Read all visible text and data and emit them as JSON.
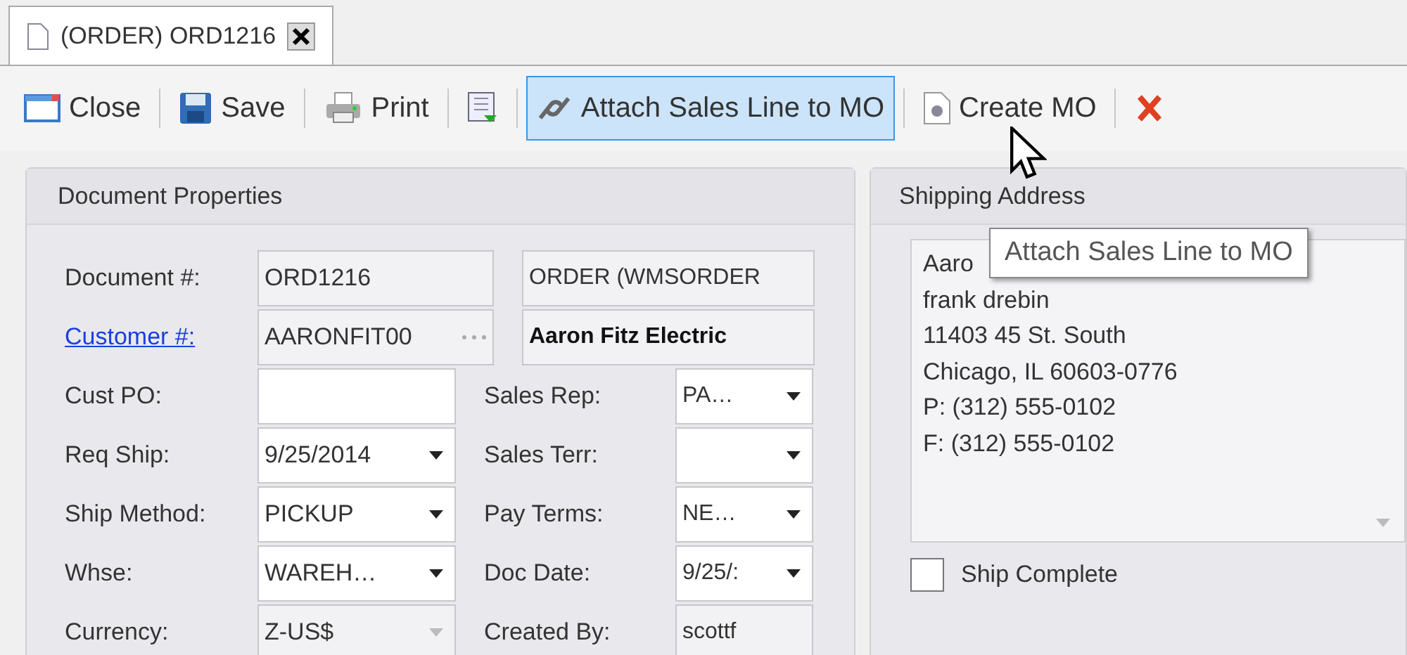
{
  "tab": {
    "title": "(ORDER) ORD1216",
    "selected": true
  },
  "toolbar": [
    {
      "label": "Close",
      "hovered": false
    },
    {
      "label": "Save",
      "hovered": false
    },
    {
      "label": "Print",
      "hovered": false
    },
    {
      "hovered": false
    },
    {
      "label": "Attach Sales Line to MO",
      "hovered": true
    },
    {
      "label": "Create MO",
      "hovered": false
    },
    {
      "hovered": false
    }
  ],
  "document_properties": {
    "title": "Document Properties",
    "top_rows": [
      {
        "label": "Document #:",
        "link": false,
        "value": "ORD1216",
        "extra": "ORDER (WMSORDER",
        "extra_bold": false,
        "lookup": false
      },
      {
        "label": "Customer #:",
        "link": true,
        "value": "AARONFIT00",
        "extra": "Aaron Fitz Electric",
        "extra_bold": true,
        "lookup": true
      }
    ],
    "rows": [
      {
        "left": {
          "label": "Cust PO:",
          "kind": "text",
          "disabled": false
        },
        "right": {
          "label": "Sales Rep:",
          "value": "PA…",
          "kind": "combo",
          "disabled": false
        }
      },
      {
        "left": {
          "label": "Req Ship:",
          "value": "9/25/2014",
          "kind": "combo",
          "disabled": false
        },
        "right": {
          "label": "Sales Terr:",
          "kind": "combo",
          "disabled": false
        }
      },
      {
        "left": {
          "label": "Ship Method:",
          "value": "PICKUP",
          "kind": "combo",
          "disabled": false
        },
        "right": {
          "label": "Pay Terms:",
          "value": "NE…",
          "kind": "combo",
          "disabled": false
        }
      },
      {
        "left": {
          "label": "Whse:",
          "value": "WAREH…",
          "kind": "combo",
          "disabled": false
        },
        "right": {
          "label": "Doc Date:",
          "value": "9/25/:",
          "kind": "combo",
          "disabled": false
        }
      },
      {
        "left": {
          "label": "Currency:",
          "value": "Z-US$",
          "kind": "combo",
          "disabled": true
        },
        "right": {
          "label": "Created By:",
          "value": "scottf",
          "kind": "text",
          "disabled": true
        }
      }
    ]
  },
  "shipping_address": {
    "title": "Shipping Address",
    "lines": [
      "Aaro",
      "frank drebin",
      "11403 45 St. South",
      "Chicago, IL 60603-0776",
      "P: (312) 555-0102",
      "F: (312) 555-0102"
    ],
    "ship_complete": {
      "label": "Ship Complete",
      "checked": false
    }
  },
  "tooltip": {
    "text": "Attach Sales Line to MO"
  }
}
